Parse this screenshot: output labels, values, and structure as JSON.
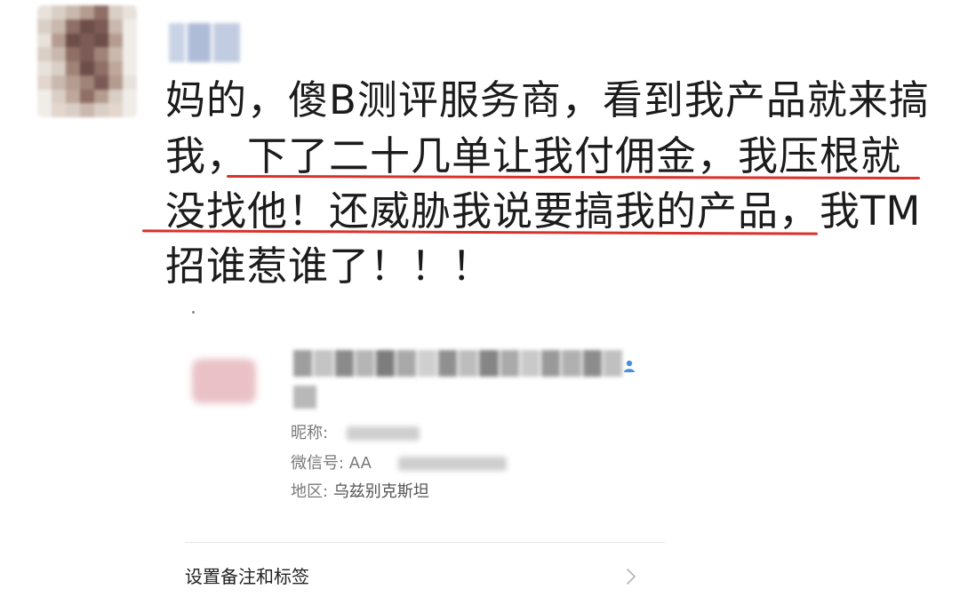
{
  "post": {
    "author_avatar_icon": "avatar-pixelated",
    "author_name_blurred": "",
    "lines": [
      "妈的，傻B测评服务商，看到我产品就来搞",
      "我，下了二十几单让我付佣金，我压根就",
      "没找他！还威胁我说要搞我的产品，我TM",
      "招谁惹谁了！！！"
    ],
    "highlight_color": "#d9322b"
  },
  "contact_card": {
    "nickname_label": "昵称:",
    "wechat_id_label": "微信号: AA",
    "region_label": "地区:",
    "region_value": "乌兹别克斯坦",
    "settings_label": "设置备注和标签",
    "gender_icon": "male-person-icon",
    "chevron_icon": "chevron-right-icon"
  },
  "colors": {
    "text": "#1b1b1b",
    "secondary_text": "#7a7a7a",
    "divider": "#e6e6e6"
  }
}
